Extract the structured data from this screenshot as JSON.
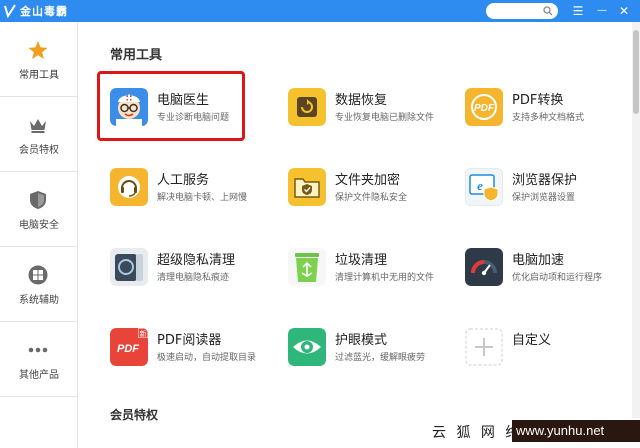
{
  "titlebar": {
    "app_name": "金山毒霸",
    "brand_color": "#2e8cf0",
    "search_icon": "search-icon",
    "menu_glyph": "☰",
    "minimize_glyph": "—",
    "close_glyph": "✕"
  },
  "sidebar": {
    "items": [
      {
        "label": "常用工具",
        "icon": "star-icon",
        "active": true
      },
      {
        "label": "会员特权",
        "icon": "crown-icon"
      },
      {
        "label": "电脑安全",
        "icon": "shield-icon"
      },
      {
        "label": "系统辅助",
        "icon": "windows-icon"
      },
      {
        "label": "其他产品",
        "icon": "more-dots-icon"
      }
    ]
  },
  "main": {
    "section_title": "常用工具",
    "section2_title": "会员特权",
    "tools": [
      {
        "name": "电脑医生",
        "desc": "专业诊断电脑问题",
        "icon": "doctor-icon",
        "highlighted": true
      },
      {
        "name": "数据恢复",
        "desc": "专业恢复电脑已删除文件",
        "icon": "data-recovery-icon"
      },
      {
        "name": "PDF转换",
        "desc": "支持多种文档格式",
        "icon": "pdf-convert-icon",
        "badge": "PDF"
      },
      {
        "name": "人工服务",
        "desc": "解决电脑卡顿、上网慢",
        "icon": "headset-icon"
      },
      {
        "name": "文件夹加密",
        "desc": "保护文件隐私安全",
        "icon": "folder-lock-icon"
      },
      {
        "name": "浏览器保护",
        "desc": "保护浏览器设置",
        "icon": "browser-shield-icon"
      },
      {
        "name": "超级隐私清理",
        "desc": "清理电脑隐私痕迹",
        "icon": "privacy-clean-icon"
      },
      {
        "name": "垃圾清理",
        "desc": "清理计算机中无用的文件",
        "icon": "trash-bin-icon"
      },
      {
        "name": "电脑加速",
        "desc": "优化启动项和运行程序",
        "icon": "speedometer-icon"
      },
      {
        "name": "PDF阅读器",
        "desc": "极速启动，自动提取目录",
        "icon": "pdf-reader-icon",
        "badge": "PDF",
        "corner": "新"
      },
      {
        "name": "护眼模式",
        "desc": "过滤蓝光，缓解眼疲劳",
        "icon": "eye-icon"
      },
      {
        "name": "自定义",
        "desc": "",
        "icon": "plus-icon"
      }
    ]
  },
  "watermark": {
    "text": "云 狐 网 络",
    "url": "www.yunhu.net"
  }
}
